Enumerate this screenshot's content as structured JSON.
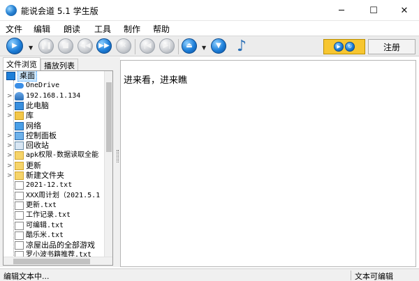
{
  "window": {
    "title": "能说会道 5.1 学生版",
    "minimize_glyph": "─",
    "maximize_glyph": "☐",
    "close_glyph": "✕"
  },
  "menu": [
    "文件",
    "编辑",
    "朗读",
    "工具",
    "制作",
    "帮助"
  ],
  "toolbar": {
    "icons": [
      "play-icon",
      "pause-icon",
      "stop-icon",
      "rewind-icon",
      "fast-forward-icon",
      "skip-icon",
      "previous-icon",
      "next-icon",
      "eject-icon",
      "down-icon",
      "music-note-icon"
    ],
    "register_label": "注册",
    "accent_blue": "#1e7fd9",
    "accent_yellow": "#f7c631"
  },
  "tabs": [
    "文件浏览",
    "播放列表"
  ],
  "tree": [
    {
      "label": "桌面",
      "icon": "desktop-icon",
      "expand": "",
      "selected": true
    },
    {
      "label": "OneDrive",
      "icon": "cloud-icon",
      "expand": ""
    },
    {
      "label": "192.168.1.134",
      "icon": "user-icon",
      "expand": ">"
    },
    {
      "label": "此电脑",
      "icon": "computer-icon",
      "expand": ">"
    },
    {
      "label": "库",
      "icon": "library-icon",
      "expand": ">"
    },
    {
      "label": "网络",
      "icon": "network-icon",
      "expand": ""
    },
    {
      "label": "控制面板",
      "icon": "control-panel-icon",
      "expand": ">"
    },
    {
      "label": "回收站",
      "icon": "recycle-bin-icon",
      "expand": ">"
    },
    {
      "label": "apk权限-数据读取全能",
      "icon": "folder-icon",
      "expand": ">"
    },
    {
      "label": "更新",
      "icon": "folder-icon",
      "expand": ">"
    },
    {
      "label": "新建文件夹",
      "icon": "folder-icon",
      "expand": ">"
    },
    {
      "label": "2021-12.txt",
      "icon": "file-icon",
      "expand": ""
    },
    {
      "label": "XXX周计划（2021.5.1",
      "icon": "file-icon",
      "expand": ""
    },
    {
      "label": "更新.txt",
      "icon": "file-icon",
      "expand": ""
    },
    {
      "label": "工作记录.txt",
      "icon": "file-icon",
      "expand": ""
    },
    {
      "label": "可编辑.txt",
      "icon": "file-icon",
      "expand": ""
    },
    {
      "label": "酷乐米.txt",
      "icon": "file-icon",
      "expand": ""
    },
    {
      "label": "凉屋出品的全部游戏",
      "icon": "file-icon",
      "expand": ""
    },
    {
      "label": "罗小波书籍推荐.txt",
      "icon": "file-icon",
      "expand": ""
    }
  ],
  "editor": {
    "text": "进来看，进来瞧"
  },
  "status": {
    "left": "编辑文本中...",
    "right": "文本可编辑"
  }
}
